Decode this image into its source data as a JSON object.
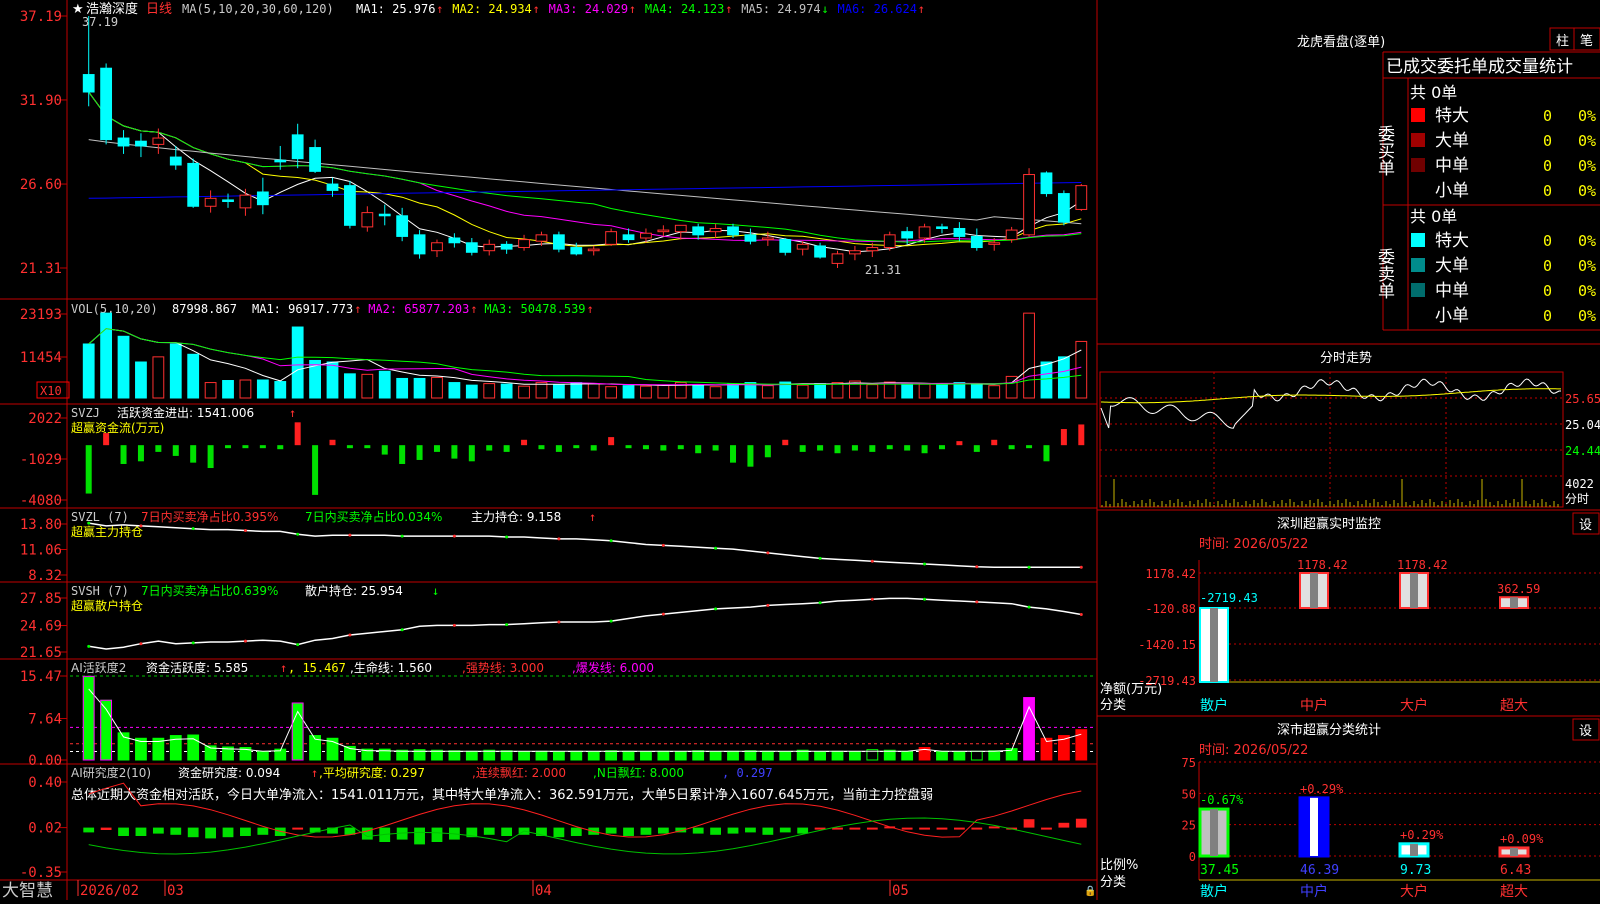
{
  "app": {
    "brand": "大智慧"
  },
  "kline": {
    "title": "浩瀚深度",
    "period": "日线",
    "ma_params": "MA(5,10,20,30,60,120)",
    "ma": [
      {
        "label": "MA1: 25.976",
        "arrow": "↑",
        "color": "#ffffff"
      },
      {
        "label": "MA2: 24.934",
        "arrow": "↑",
        "color": "#ffff00"
      },
      {
        "label": "MA3: 24.029",
        "arrow": "↑",
        "color": "#ff00ff"
      },
      {
        "label": "MA4: 24.123",
        "arrow": "↑",
        "color": "#00ff00"
      },
      {
        "label": "MA5: 24.974",
        "arrow": "↓",
        "color": "#c0c0c0"
      },
      {
        "label": "MA6: 26.624",
        "arrow": "↑",
        "color": "#0000ff"
      }
    ],
    "y_ticks": [
      "37.19",
      "31.90",
      "26.60",
      "21.31"
    ],
    "hi_label": "37.19",
    "lo_label": "21.31",
    "candles": [
      [
        33.5,
        37.19,
        31.5,
        32.4
      ],
      [
        33.9,
        34.2,
        29.1,
        29.4
      ],
      [
        29.5,
        30.0,
        28.5,
        29.0
      ],
      [
        29.3,
        29.8,
        28.3,
        29.0
      ],
      [
        29.1,
        30.1,
        28.5,
        29.5
      ],
      [
        28.3,
        29.0,
        27.5,
        27.8
      ],
      [
        27.9,
        28.2,
        25.1,
        25.2
      ],
      [
        25.2,
        26.2,
        24.8,
        25.7
      ],
      [
        25.6,
        26.0,
        25.1,
        25.5
      ],
      [
        25.1,
        26.3,
        24.6,
        25.9
      ],
      [
        26.1,
        27.0,
        24.7,
        25.3
      ],
      [
        28.1,
        29.0,
        27.5,
        28.0
      ],
      [
        29.7,
        30.4,
        27.6,
        28.2
      ],
      [
        28.9,
        29.4,
        27.3,
        27.4
      ],
      [
        26.6,
        27.0,
        25.8,
        26.2
      ],
      [
        26.5,
        26.8,
        23.8,
        24.0
      ],
      [
        23.9,
        25.2,
        23.6,
        24.8
      ],
      [
        24.7,
        25.3,
        24.0,
        24.6
      ],
      [
        24.6,
        25.1,
        23.0,
        23.3
      ],
      [
        23.4,
        23.7,
        21.9,
        22.2
      ],
      [
        22.4,
        23.1,
        22.0,
        22.9
      ],
      [
        23.2,
        23.5,
        22.6,
        22.9
      ],
      [
        22.9,
        23.2,
        22.1,
        22.3
      ],
      [
        22.4,
        23.1,
        22.1,
        22.8
      ],
      [
        22.8,
        23.0,
        22.2,
        22.5
      ],
      [
        22.6,
        23.4,
        22.4,
        23.1
      ],
      [
        23.0,
        23.6,
        22.7,
        23.4
      ],
      [
        23.4,
        23.6,
        22.3,
        22.5
      ],
      [
        22.6,
        22.9,
        22.1,
        22.2
      ],
      [
        22.4,
        22.7,
        22.1,
        22.5
      ],
      [
        22.8,
        23.8,
        22.7,
        23.6
      ],
      [
        23.4,
        23.8,
        22.9,
        23.1
      ],
      [
        23.2,
        23.8,
        22.9,
        23.5
      ],
      [
        23.6,
        24.0,
        23.3,
        23.7
      ],
      [
        23.6,
        24.0,
        23.1,
        24.0
      ],
      [
        23.9,
        24.1,
        23.1,
        23.4
      ],
      [
        23.6,
        24.1,
        23.2,
        23.8
      ],
      [
        23.9,
        24.1,
        23.2,
        23.4
      ],
      [
        23.4,
        23.8,
        22.8,
        23.0
      ],
      [
        23.1,
        23.6,
        22.7,
        23.2
      ],
      [
        23.1,
        23.2,
        22.1,
        22.3
      ],
      [
        22.5,
        23.0,
        22.1,
        22.8
      ],
      [
        22.7,
        22.9,
        21.9,
        22.0
      ],
      [
        21.6,
        22.4,
        21.31,
        22.2
      ],
      [
        22.2,
        22.7,
        21.8,
        22.4
      ],
      [
        22.4,
        22.9,
        22.0,
        22.6
      ],
      [
        22.6,
        23.6,
        22.4,
        23.4
      ],
      [
        23.6,
        23.9,
        22.8,
        23.2
      ],
      [
        23.2,
        24.1,
        22.9,
        23.9
      ],
      [
        23.9,
        24.1,
        23.5,
        23.8
      ],
      [
        23.8,
        24.2,
        23.0,
        23.3
      ],
      [
        23.3,
        23.8,
        22.4,
        22.6
      ],
      [
        22.8,
        23.2,
        22.4,
        22.9
      ],
      [
        23.1,
        23.9,
        22.9,
        23.7
      ],
      [
        23.4,
        27.6,
        23.3,
        27.2
      ],
      [
        27.3,
        27.4,
        25.8,
        26.0
      ],
      [
        26.0,
        26.2,
        24.0,
        24.2
      ],
      [
        25.0,
        26.6,
        24.9,
        26.5
      ]
    ]
  },
  "vol": {
    "label": "VOL(5,10,20)",
    "value": "87998.867",
    "items": [
      {
        "label": "MA1: 96917.773",
        "arrow": "↑",
        "color": "#ffffff"
      },
      {
        "label": "MA2: 65877.203",
        "arrow": "↑",
        "color": "#ff00ff"
      },
      {
        "label": "MA3: 50478.539",
        "arrow": "↑",
        "color": "#00ff00"
      }
    ],
    "y_ticks": [
      "23193",
      "11454"
    ],
    "unit": "X10",
    "values": [
      1050,
      1650,
      1200,
      700,
      800,
      1050,
      850,
      300,
      340,
      350,
      350,
      320,
      1380,
      730,
      700,
      470,
      460,
      520,
      380,
      380,
      400,
      300,
      250,
      280,
      270,
      230,
      300,
      260,
      300,
      280,
      220,
      240,
      230,
      250,
      300,
      260,
      220,
      270,
      300,
      240,
      310,
      250,
      280,
      300,
      330,
      260,
      310,
      270,
      270,
      260,
      300,
      260,
      240,
      420,
      1650,
      700,
      800,
      1100
    ]
  },
  "svzj": {
    "label": "SVZJ",
    "text": "活跃资金进出: 1541.006",
    "arrow": "↑",
    "subtitle": "超赢资金流(万元)",
    "y_ticks": [
      "2022",
      "-1029",
      "-4080"
    ],
    "values": [
      -3600,
      900,
      -1400,
      -1200,
      -500,
      -800,
      -1300,
      -1700,
      -200,
      -120,
      -180,
      -300,
      1700,
      -3700,
      400,
      -180,
      -100,
      -700,
      -1400,
      -1100,
      -500,
      -1000,
      -1200,
      -400,
      -500,
      400,
      -300,
      -500,
      -200,
      -400,
      600,
      -200,
      -300,
      -400,
      -300,
      -600,
      -400,
      -1300,
      -1600,
      -900,
      400,
      -500,
      -400,
      -600,
      -400,
      -500,
      -300,
      -400,
      -600,
      -300,
      300,
      -500,
      400,
      -300,
      -200,
      -1200,
      1200,
      1541
    ],
    "min": -4080,
    "max": 2022
  },
  "svzl": {
    "label": "SVZL (7)",
    "text1": "7日内买卖净占比0.395%",
    "text2": "7日内买卖净占比0.034%",
    "text3": "主力持仓: 9.158",
    "arrow": "↑",
    "subtitle": "超赢主力持仓",
    "y_ticks": [
      "13.80",
      "11.06",
      "8.32"
    ],
    "values": [
      13.9,
      13.6,
      13.7,
      13.6,
      13.5,
      13.4,
      13.3,
      13.2,
      13.2,
      13.1,
      13.0,
      13.0,
      12.7,
      12.5,
      12.6,
      12.6,
      12.6,
      12.6,
      12.5,
      12.5,
      12.5,
      12.5,
      12.5,
      12.5,
      12.4,
      12.4,
      12.3,
      12.2,
      12.2,
      12.1,
      12.0,
      11.8,
      11.6,
      11.5,
      11.4,
      11.3,
      11.2,
      11.1,
      10.9,
      10.7,
      10.5,
      10.3,
      10.1,
      10.0,
      9.9,
      9.8,
      9.7,
      9.6,
      9.5,
      9.4,
      9.3,
      9.2,
      9.15,
      9.15,
      9.15,
      9.15,
      9.15,
      9.158
    ],
    "min": 8.32,
    "max": 13.8
  },
  "svsh": {
    "label": "SVSH (7)",
    "text1": "7日内买卖净占比0.639%",
    "text2": "散户持仓: 25.954",
    "arrow": "↓",
    "subtitle": "超赢散户持仓",
    "y_ticks": [
      "27.85",
      "24.69",
      "21.65"
    ],
    "values": [
      22.3,
      22.0,
      22.2,
      22.6,
      22.9,
      22.6,
      22.7,
      22.8,
      22.8,
      22.9,
      23.0,
      22.9,
      22.5,
      23.0,
      23.2,
      23.6,
      23.8,
      24.0,
      24.2,
      24.6,
      24.7,
      24.7,
      24.7,
      24.8,
      24.8,
      24.9,
      25.0,
      25.1,
      25.1,
      25.1,
      25.2,
      25.5,
      25.8,
      26.0,
      26.2,
      26.4,
      26.6,
      26.7,
      26.8,
      27.0,
      27.1,
      27.2,
      27.3,
      27.5,
      27.6,
      27.7,
      27.8,
      27.8,
      27.7,
      27.6,
      27.5,
      27.4,
      27.3,
      27.2,
      26.8,
      26.6,
      26.3,
      25.954
    ],
    "min": 21.65,
    "max": 27.85
  },
  "ai_active": {
    "label": "AI活跃度2",
    "text1": "资金活跃度: 5.585",
    "arrow1": "↑",
    "text2": ", 15.467",
    "text3": ",生命线: 1.560",
    "text4": ",强势线: 3.000",
    "text5": ",爆发线: 6.000",
    "y_ticks": [
      "15.47",
      "7.64",
      "0.00"
    ],
    "values": [
      15.4,
      11.0,
      5.0,
      4.0,
      4.0,
      4.5,
      4.6,
      2.6,
      2.4,
      2.3,
      1.5,
      2.0,
      10.5,
      4.5,
      4.0,
      2.5,
      2.0,
      2.0,
      1.8,
      1.9,
      1.8,
      1.7,
      1.6,
      1.8,
      1.7,
      1.5,
      1.6,
      1.5,
      1.6,
      1.5,
      1.7,
      1.6,
      1.5,
      1.6,
      1.5,
      1.7,
      1.5,
      1.6,
      1.7,
      1.6,
      1.5,
      1.8,
      1.5,
      1.6,
      1.5,
      1.9,
      1.8,
      1.5,
      2.3,
      1.6,
      1.5,
      1.6,
      1.7,
      2.1,
      11.5,
      4.0,
      4.5,
      5.585
    ],
    "min": 0,
    "max": 15.47
  },
  "ai_research": {
    "label": "AI研究度2(10)",
    "text1": "资金研究度: 0.094",
    "arrow1": "↑",
    "text2": ",平均研究度: 0.297",
    "text3": ",连续飘红: 2.000",
    "text4": ",N日飘红: 8.000",
    "text5": ", 0.297",
    "y_ticks": [
      "0.40",
      "0.02",
      "-0.35"
    ],
    "summary": "总体近期大资金相对活跃，今日大单净流入：1541.011万元，其中特大单净流入：362.591万元，大单5日累计净入1607.645万元，当前主力控盘弱",
    "values": [
      -0.02,
      0.0,
      -0.05,
      -0.05,
      -0.03,
      -0.04,
      -0.06,
      -0.07,
      -0.06,
      -0.05,
      -0.04,
      -0.05,
      0.02,
      -0.02,
      -0.03,
      -0.04,
      -0.08,
      -0.1,
      -0.08,
      -0.12,
      -0.1,
      -0.08,
      -0.06,
      -0.04,
      -0.05,
      -0.04,
      -0.05,
      -0.06,
      -0.05,
      -0.04,
      -0.03,
      -0.05,
      -0.04,
      -0.03,
      -0.02,
      -0.03,
      -0.04,
      -0.03,
      -0.02,
      -0.04,
      -0.02,
      -0.03,
      0.01,
      0.02,
      0.01,
      0.02,
      0.03,
      0.02,
      0.01,
      0.02,
      0.01,
      0.02,
      0.03,
      0.02,
      0.09,
      0.02,
      0.06,
      0.094
    ],
    "min": -0.35,
    "max": 0.4
  },
  "x_axis": [
    "2026/02",
    "03",
    "04",
    "05"
  ],
  "right": {
    "lhkp": {
      "title": "龙虎看盘(逐单)",
      "tab1": "柱",
      "tab2": "笔",
      "header": "已成交委托单成交量统计",
      "buy_label": "委买单",
      "sell_label": "委卖单",
      "buy_total": "共 0单",
      "sell_total": "共 0单",
      "buy_rows": [
        {
          "name": "特大",
          "n": "0",
          "pct": "0%",
          "color": "#ff0000"
        },
        {
          "name": "大单",
          "n": "0",
          "pct": "0%",
          "color": "#a00000"
        },
        {
          "name": "中单",
          "n": "0",
          "pct": "0%",
          "color": "#700000"
        },
        {
          "name": "小单",
          "n": "0",
          "pct": "0%",
          "color": ""
        }
      ],
      "sell_rows": [
        {
          "name": "特大",
          "n": "0",
          "pct": "0%",
          "color": "#00ffff"
        },
        {
          "name": "大单",
          "n": "0",
          "pct": "0%",
          "color": "#008c8c"
        },
        {
          "name": "中单",
          "n": "0",
          "pct": "0%",
          "color": "#006d6d"
        },
        {
          "name": "小单",
          "n": "0",
          "pct": "0%",
          "color": ""
        }
      ]
    },
    "intraday": {
      "title": "分时走势",
      "y_ticks": [
        "25.65",
        "25.04",
        "24.44"
      ],
      "vol_tick": "4022",
      "vol_label": "分时"
    },
    "monitor": {
      "title": "深圳超赢实时监控",
      "btn": "设",
      "time": "时间: 2026/05/22",
      "y_ticks": [
        "1178.42",
        "-120.88",
        "-1420.15",
        "-2719.43"
      ],
      "y_label": "净额(万元)",
      "x_label": "分类",
      "categories": [
        "散户",
        "中户",
        "大户",
        "超大"
      ],
      "values": [
        -2719.43,
        1178.42,
        1178.42,
        362.59
      ],
      "value_labels": [
        "-2719.43",
        "1178.42",
        "1178.42",
        "362.59"
      ]
    },
    "classify": {
      "title": "深市超赢分类统计",
      "btn": "设",
      "time": "时间: 2026/05/22",
      "y_ticks": [
        "75",
        "50",
        "25",
        "0"
      ],
      "y_label": "比例%",
      "x_label": "分类",
      "categories": [
        "散户",
        "中户",
        "大户",
        "超大"
      ],
      "values": [
        37.45,
        46.39,
        9.73,
        6.43
      ],
      "value_labels": [
        "37.45",
        "46.39",
        "9.73",
        "6.43"
      ],
      "change_labels": [
        "-0.67%",
        "+0.29%",
        "+0.29%",
        "+0.09%"
      ]
    }
  }
}
